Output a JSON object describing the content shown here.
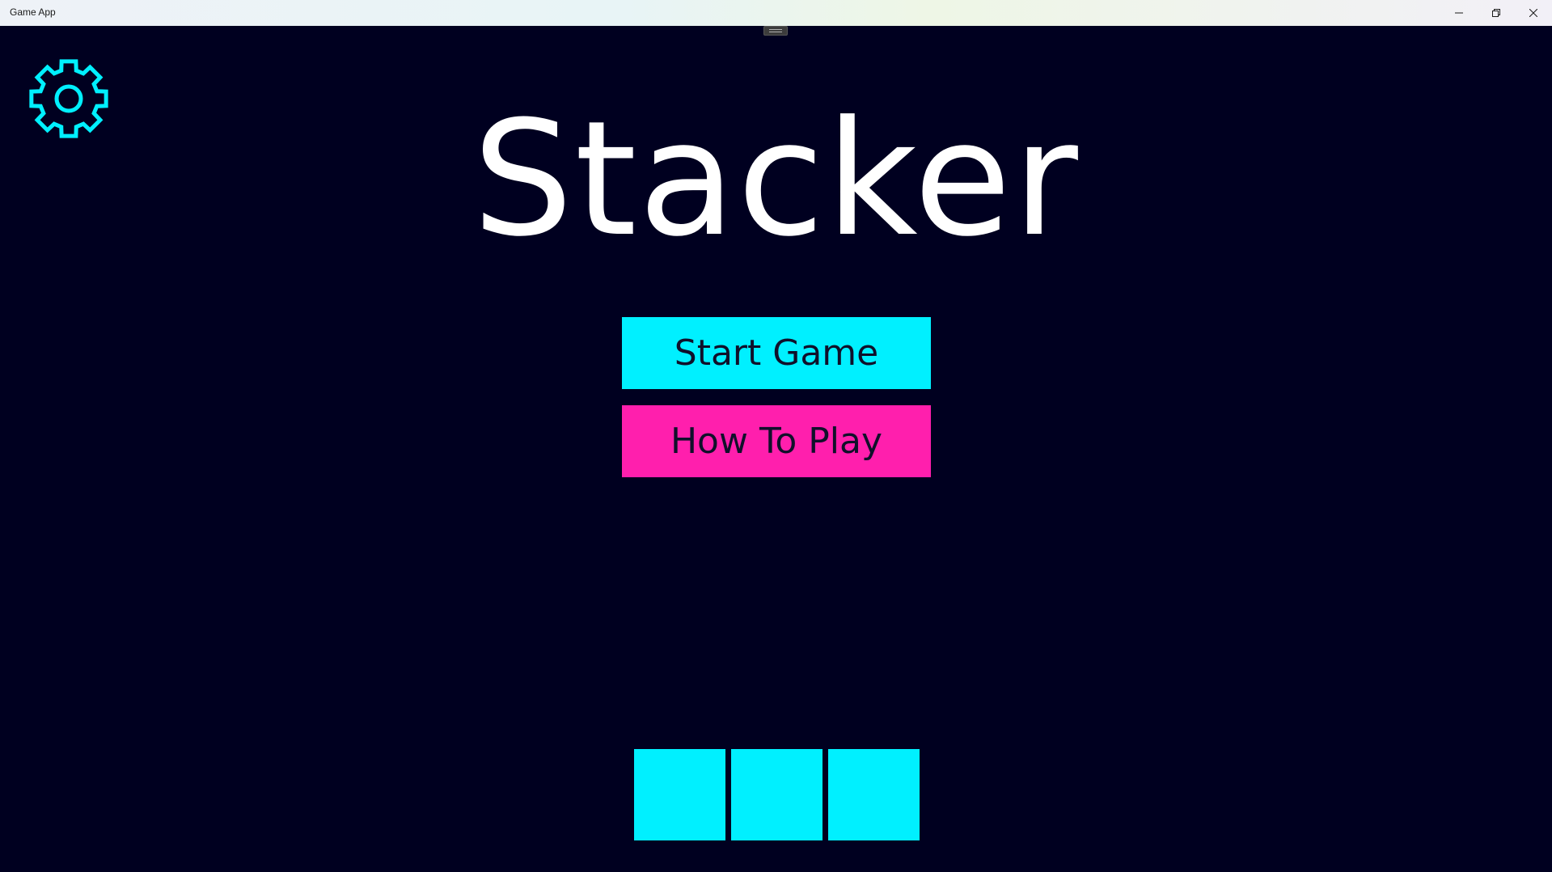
{
  "window": {
    "title": "Game App",
    "controls": {
      "minimize_icon": "minimize-icon",
      "maximize_icon": "restore-icon",
      "close_icon": "close-icon"
    }
  },
  "settings": {
    "icon": "gear-icon",
    "color": "#00f0ff"
  },
  "game": {
    "title": "Stacker"
  },
  "menu": {
    "start_label": "Start Game",
    "howto_label": "How To Play",
    "start_color": "#00f0ff",
    "howto_color": "#ff1fad"
  },
  "stack": {
    "block_count": 3,
    "block_color": "#00f0ff"
  },
  "colors": {
    "background": "#000020",
    "title_text": "#ffffff"
  }
}
